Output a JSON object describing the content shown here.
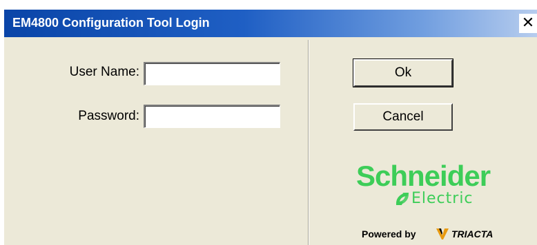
{
  "window": {
    "title": "EM4800 Configuration Tool Login",
    "close_glyph": "✕"
  },
  "form": {
    "username_label": "User Name:",
    "username_value": "",
    "password_label": "Password:",
    "password_value": ""
  },
  "buttons": {
    "ok": "Ok",
    "cancel": "Cancel"
  },
  "branding": {
    "logo_word": "Schneider",
    "logo_sub": "Electric",
    "powered_by": "Powered by",
    "partner": "TRIACTA",
    "logo_color": "#3dcd58"
  },
  "colors": {
    "titlebar_start": "#0a45a8",
    "dialog_bg": "#ece9d8"
  }
}
